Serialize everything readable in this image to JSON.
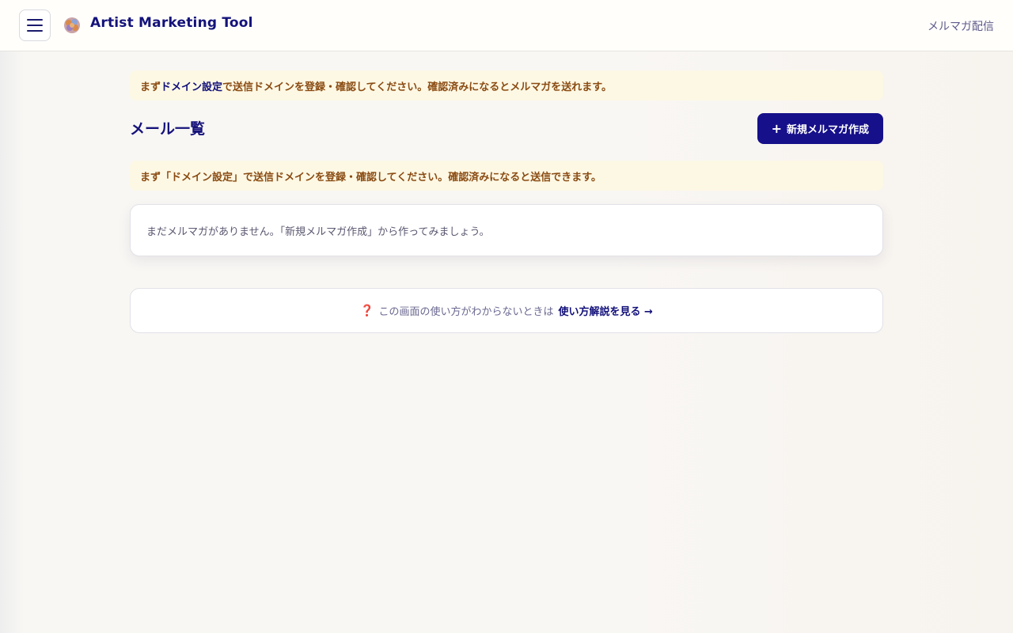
{
  "header": {
    "app_title": "Artist Marketing Tool",
    "nav_link": "メルマガ配信"
  },
  "notice_top": {
    "prefix": "まず ",
    "link": "ドメイン設定",
    "suffix": "で送信ドメインを登録・確認してください。確認済みになるとメルマガを送れます。"
  },
  "main": {
    "page_title": "メール一覧",
    "new_button_icon": "+",
    "new_button_label": "新規メルマガ作成"
  },
  "notice_list": {
    "text": "まず「ドメイン設定」で送信ドメインを登録・確認してください。確認済みになると送信できます。"
  },
  "empty_state": {
    "text": "まだメルマガがありません。「新規メルマガ作成」から作ってみましょう。"
  },
  "help": {
    "icon": "❓",
    "text": "この画面の使い方がわからないときは",
    "link": "使い方解説を見る →"
  },
  "colors": {
    "accent": "#16108a",
    "notice_bg": "#fdf8e4",
    "notice_text": "#8a4b12"
  }
}
